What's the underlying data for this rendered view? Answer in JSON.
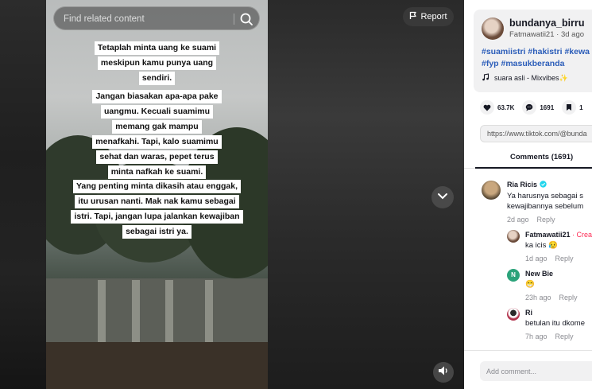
{
  "search": {
    "placeholder": "Find related content"
  },
  "report_label": "Report",
  "video_captions": [
    [
      "Tetaplah minta uang ke suami",
      "meskipun kamu punya uang",
      "sendiri."
    ],
    [
      "Jangan biasakan apa-apa pake",
      "uangmu. Kecuali suamimu",
      "memang gak mampu",
      "menafkahi. Tapi, kalo suamimu",
      "sehat dan waras, pepet terus",
      "minta nafkah ke suami."
    ],
    [
      "Yang penting minta dikasih atau enggak,",
      "itu urusan nanti. Mak nak kamu sebagai",
      "istri. Tapi, jangan lupa jalankan kewajiban",
      "sebagai istri ya."
    ]
  ],
  "author": {
    "username": "bundanya_birru",
    "handle": "Fatmawatii21",
    "time": "3d ago",
    "hashtags_line1": "#suamiistri #hakistri #kewa",
    "hashtags_line2": "#fyp #masukberanda",
    "sound": "suara asli - Mixvibes✨"
  },
  "stats": {
    "likes": "63.7K",
    "comments": "1691",
    "saves": "1"
  },
  "share_link": "https://www.tiktok.com/@bunda",
  "comments_tab": "Comments (1691)",
  "comments": [
    {
      "name": "Ria Ricis",
      "verified": true,
      "text1": "Ya harusnya sebagai s",
      "text2": "kewajibannya sebelum",
      "time": "2d ago",
      "reply": "Reply"
    },
    {
      "name": "Fatmawatii21",
      "creator": "· Crea",
      "text1": "ka icis 😥",
      "time": "1d ago",
      "reply": "Reply"
    },
    {
      "name": "New Bie",
      "initial": "N",
      "text1": "😁",
      "time": "23h ago",
      "reply": "Reply"
    },
    {
      "name": "Ri",
      "text1": "betulan itu dkome",
      "time": "7h ago",
      "reply": "Reply"
    }
  ],
  "add_comment_placeholder": "Add comment...",
  "colors": {
    "accent": "#fe2c55",
    "hashtag": "#2b5db9",
    "new_bie_avatar": "#2ba37a"
  }
}
